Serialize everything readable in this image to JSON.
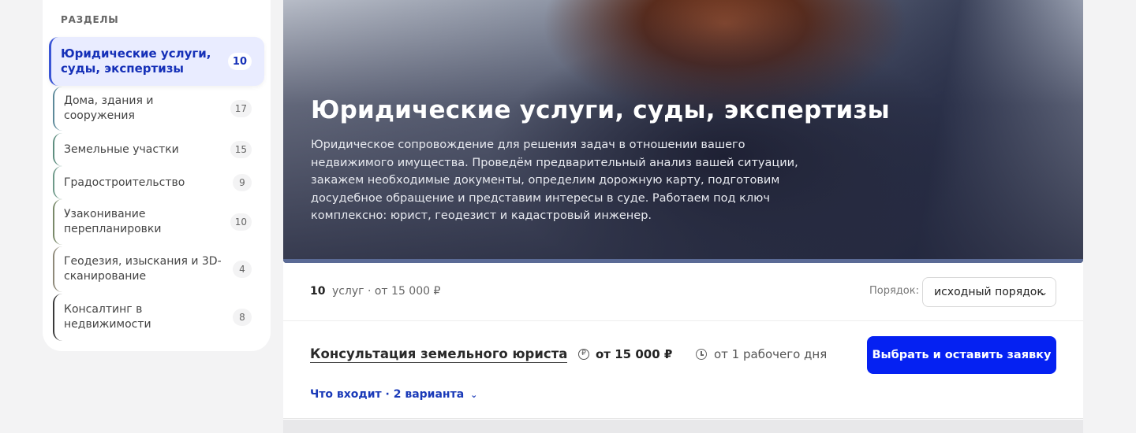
{
  "sidebar": {
    "title": "РАЗДЕЛЫ",
    "items": [
      {
        "label": "Юридические услуги, суды, экспертизы",
        "count": "10"
      },
      {
        "label": "Дома, здания и сооружения",
        "count": "17"
      },
      {
        "label": "Земельные участки",
        "count": "15"
      },
      {
        "label": "Градостроительство",
        "count": "9"
      },
      {
        "label": "Узаконивание перепланировки",
        "count": "10"
      },
      {
        "label": "Геодезия, изыскания и 3D-сканирование",
        "count": "4"
      },
      {
        "label": "Консалтинг в недвижимости",
        "count": "8"
      }
    ]
  },
  "hero": {
    "title": "Юридические услуги, суды, экспертизы",
    "description": "Юридическое сопровождение для решения задач в отношении вашего недвижимого имущества. Проведём предварительный анализ вашей ситуации, закажем необходимые документы, определим дорожную карту, подготовим досудебное обращение и представим интересы в суде. Работаем под ключ комплексно: юрист, геодезист и кадастровый инженер."
  },
  "toolbar": {
    "count": "10",
    "count_suffix": "услуг · от 15 000 ₽",
    "sort_label": "Порядок:",
    "sort_value": "исходный порядок"
  },
  "service": {
    "name": "Консультация земельного юриста",
    "price": "от 15 000 ₽",
    "term": "от 1 рабочего дня",
    "cta": "Выбрать и оставить заявку",
    "includes": "Что входит · 2 варианта"
  },
  "colors": {
    "accent": "#0521f2",
    "active_bg": "#e9ecff",
    "active_text": "#1530b8"
  },
  "icons": {
    "price": "ruble-coin-icon",
    "term": "clock-icon",
    "sort": "chevron-down-icon",
    "includes": "chevron-down-icon"
  }
}
